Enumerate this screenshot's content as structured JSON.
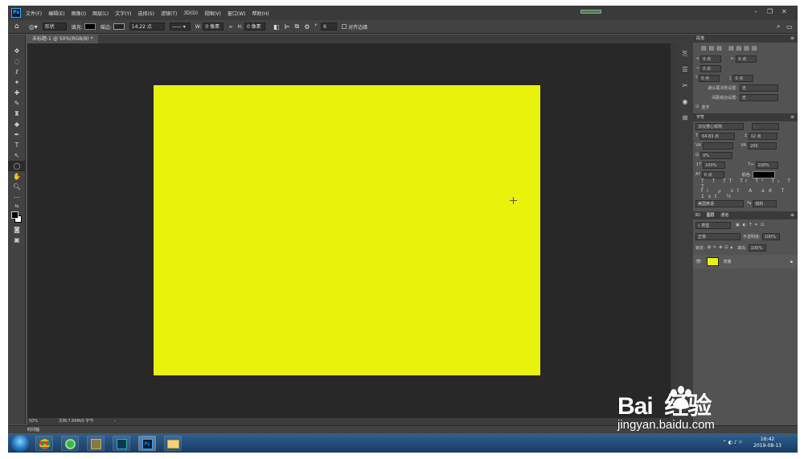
{
  "app": {
    "logo": "Ps"
  },
  "menu": [
    "文件(F)",
    "编辑(E)",
    "图像(I)",
    "图层(L)",
    "文字(Y)",
    "选择(S)",
    "滤镜(T)",
    "3D(D)",
    "视图(V)",
    "窗口(W)",
    "帮助(H)"
  ],
  "options": {
    "mode": "形状",
    "fill_label": "填充:",
    "stroke_label": "描边:",
    "stroke_size": "14.22 点",
    "w_label": "W:",
    "w_value": "0 像素",
    "h_label": "H:",
    "h_value": "0 像素",
    "radius_value": "6",
    "align_edges": "对齐边缘"
  },
  "document": {
    "tab": "未标题-1 @ 50%(RGB/8) *",
    "color": "#e9f20a"
  },
  "status": {
    "zoom": "50%",
    "docsize": "文档:7.66M/0 字节",
    "timeline": "时间轴"
  },
  "paragraph_panel": {
    "title": "段落",
    "fields": [
      "0 点",
      "0 点",
      "0 点",
      "0 点",
      "0 点"
    ],
    "avoid_label": "避头尾法则设置:",
    "avoid_value": "无",
    "spacing_label": "间距组合设置:",
    "spacing_value": "无",
    "hyphen": "连字"
  },
  "character_panel": {
    "title": "字符",
    "font": "汉仪菱心体简",
    "style": "-",
    "size": "64.83 点",
    "leading": "12 点",
    "tracking": "200",
    "kerning_pct": "0%",
    "vscale": "100%",
    "hscale": "100%",
    "baseline": "0 点",
    "color_label": "颜色:",
    "language": "美国英语",
    "aa": "锐利"
  },
  "layers_panel": {
    "tabs": [
      "3D",
      "图层",
      "通道"
    ],
    "kind": "类型",
    "blend": "正常",
    "opacity_label": "不透明度:",
    "opacity": "100%",
    "lock_label": "锁定:",
    "fill_label": "填充:",
    "fill": "100%",
    "layer_name": "背景"
  },
  "taskbar": {
    "time": "16:42",
    "date": "2019-08-13"
  },
  "watermark": {
    "brand": "Bai  经验",
    "url": "jingyan.baidu.com"
  },
  "colors": {
    "accent": "#31a8ff",
    "canvas_bg": "#282828",
    "ui_bg": "#535353"
  }
}
